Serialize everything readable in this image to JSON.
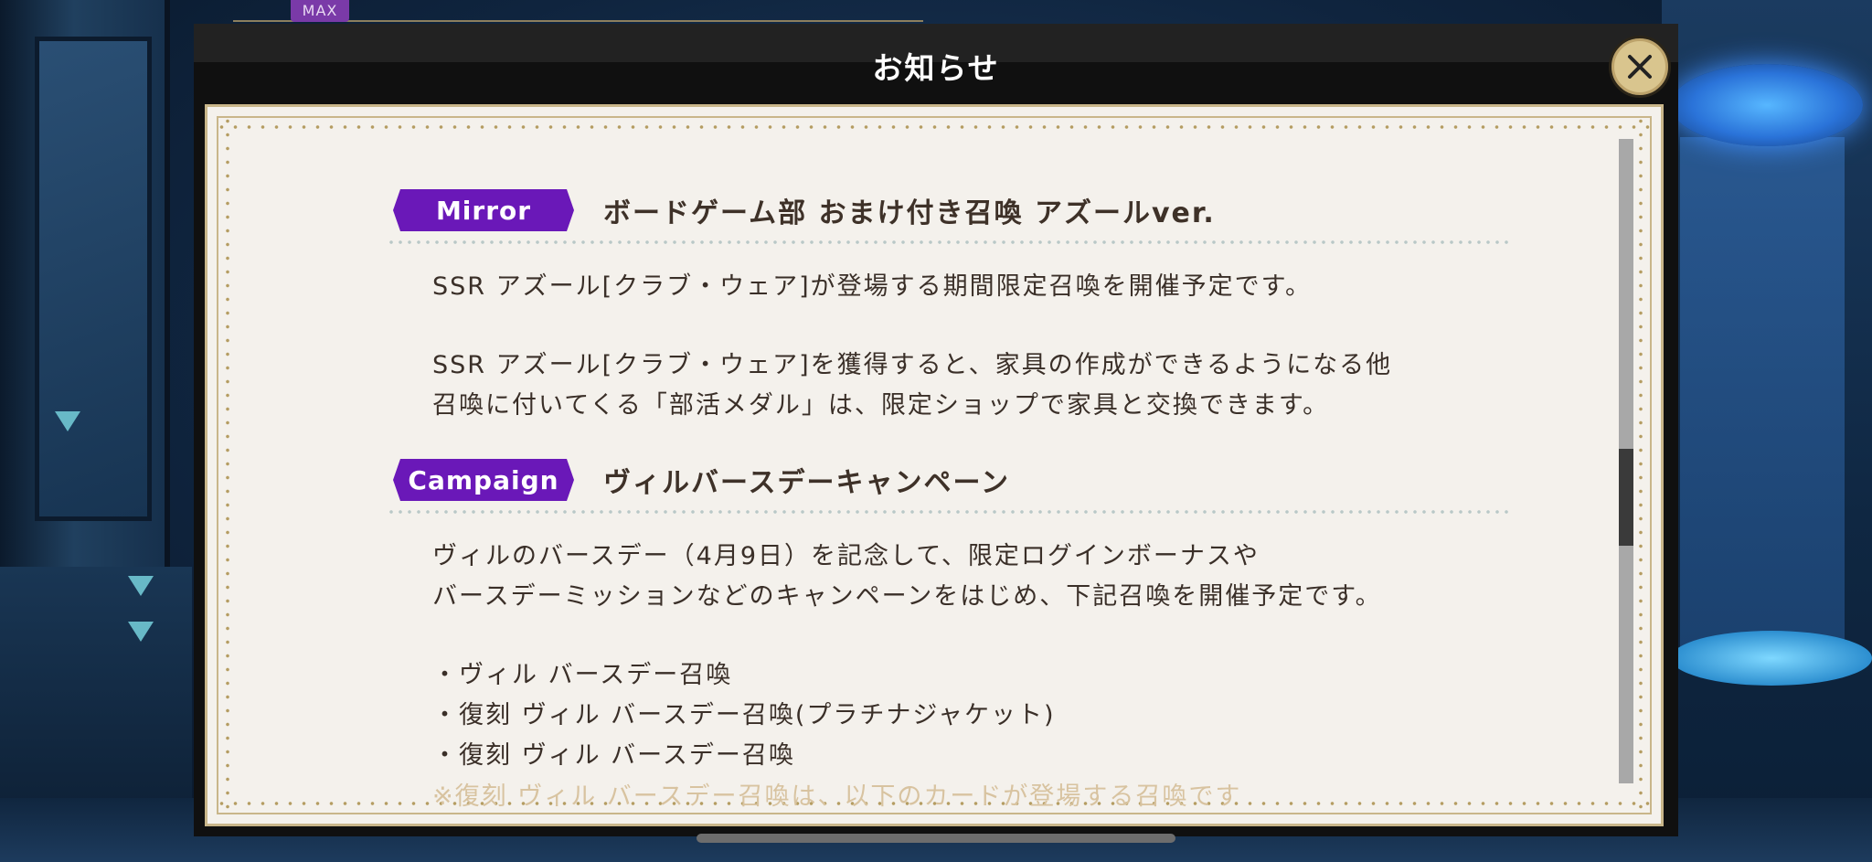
{
  "hud": {
    "max_label": "MAX"
  },
  "dialog": {
    "title": "お知らせ",
    "close_icon": "close-icon",
    "sections": [
      {
        "tag": "Mirror",
        "title": "ボードゲーム部 おまけ付き召喚 アズールver.",
        "lines": [
          "SSR アズール[クラブ・ウェア]が登場する期間限定召喚を開催予定です。",
          "SSR アズール[クラブ・ウェア]を獲得すると、家具の作成ができるようになる他",
          "召喚に付いてくる「部活メダル」は、限定ショップで家具と交換できます。"
        ]
      },
      {
        "tag": "Campaign",
        "title": "ヴィルバースデーキャンペーン",
        "lines": [
          "ヴィルのバースデー（4月9日）を記念して、限定ログインボーナスや",
          "バースデーミッションなどのキャンペーンをはじめ、下記召喚を開催予定です。",
          "・ヴィル バースデー召喚",
          "・復刻 ヴィル バースデー召喚(プラチナジャケット)",
          "・復刻 ヴィル バースデー召喚",
          "※復刻 ヴィル バースデー召喚は、以下のカードが登場する召喚です"
        ]
      }
    ]
  },
  "colors": {
    "tag_bg": "#6a18b8",
    "panel_bg": "#f4f1ec",
    "text": "#3a2f28",
    "border_gold": "#c9b68a"
  }
}
